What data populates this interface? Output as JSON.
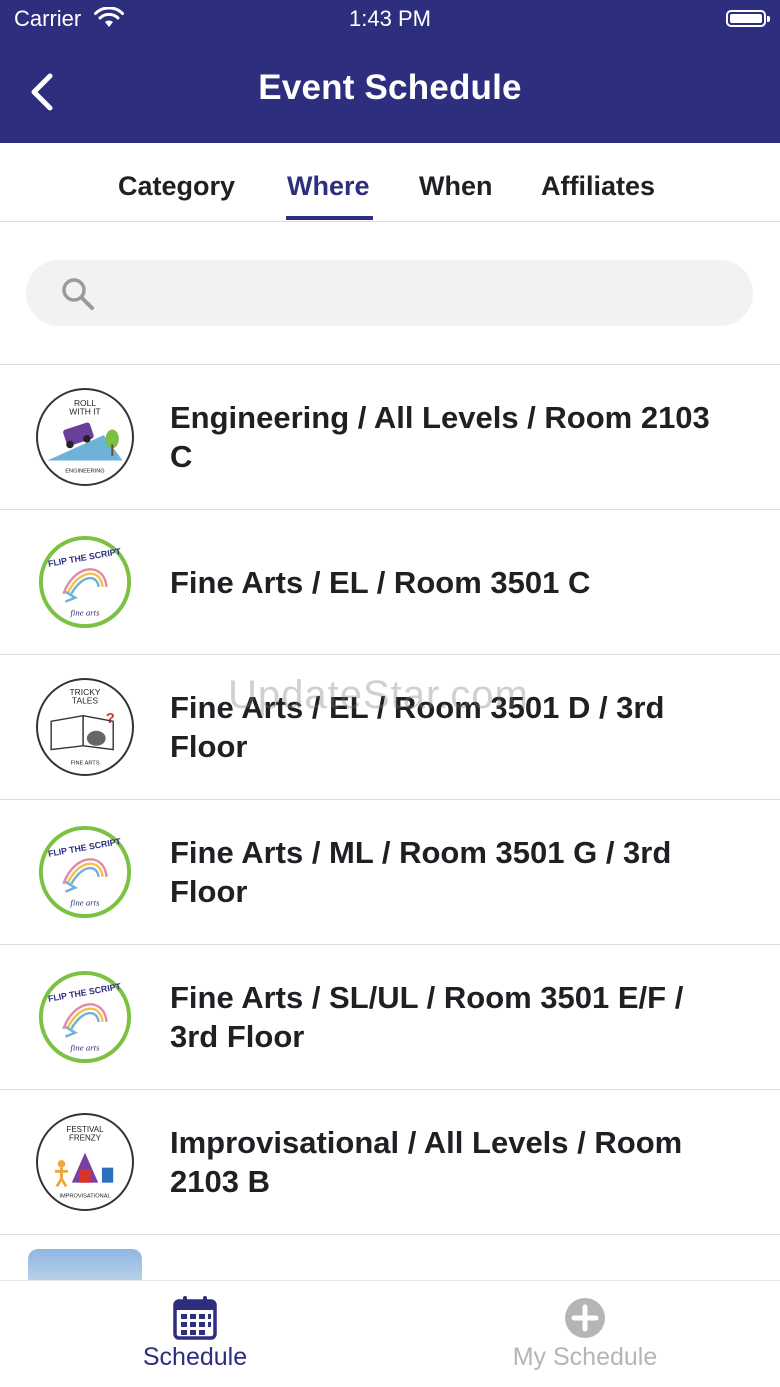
{
  "status_bar": {
    "carrier": "Carrier",
    "time": "1:43 PM"
  },
  "header": {
    "title": "Event Schedule"
  },
  "tabs": [
    {
      "label": "Category"
    },
    {
      "label": "Where"
    },
    {
      "label": "When"
    },
    {
      "label": "Affiliates"
    }
  ],
  "active_tab": "Where",
  "search": {
    "placeholder": "",
    "value": ""
  },
  "rows": [
    {
      "label": "Engineering / All Levels / Room 2103 C",
      "logo": "Roll With It",
      "logo_sub": "ENGINEERING"
    },
    {
      "label": "Fine Arts / EL / Room 3501 C",
      "logo": "Flip The Script",
      "logo_sub": "fine arts"
    },
    {
      "label": "Fine Arts / EL / Room 3501 D / 3rd Floor",
      "logo": "Tricky Tales",
      "logo_sub": "FINE ARTS"
    },
    {
      "label": "Fine Arts / ML / Room 3501 G / 3rd Floor",
      "logo": "Flip The Script",
      "logo_sub": "fine arts"
    },
    {
      "label": "Fine Arts / SL/UL / Room 3501 E/F / 3rd Floor",
      "logo": "Flip The Script",
      "logo_sub": "fine arts"
    },
    {
      "label": "Improvisational / All Levels / Room 2103 B",
      "logo": "Festival Frenzy",
      "logo_sub": "IMPROVISATIONAL"
    }
  ],
  "watermark": "UpdateStar.com",
  "tab_bar": {
    "schedule_label": "Schedule",
    "my_schedule_label": "My Schedule"
  },
  "colors": {
    "brand": "#2d2e7d",
    "green_ring": "#7cc142",
    "inactive": "#b5b5b5"
  }
}
